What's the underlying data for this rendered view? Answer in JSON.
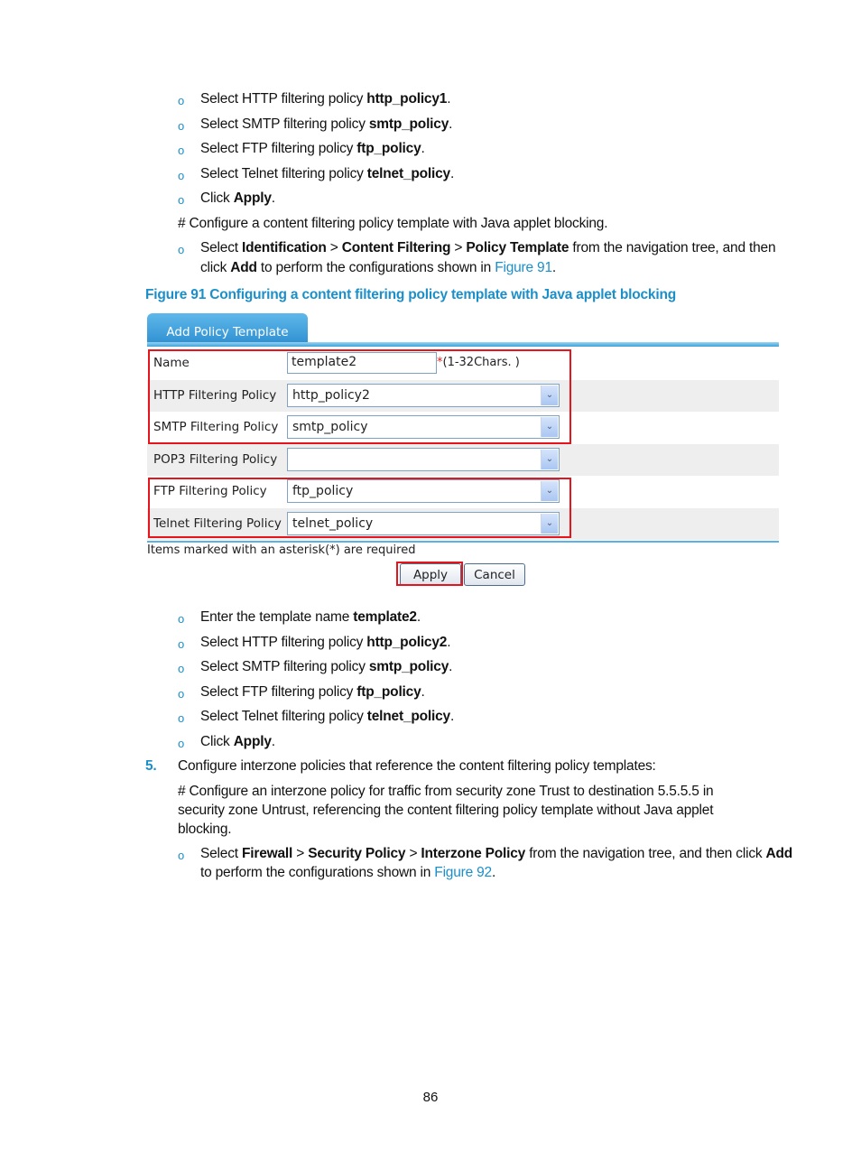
{
  "steps_before": [
    {
      "prefix": "Select HTTP filtering policy ",
      "bold": "http_policy1",
      "suffix": "."
    },
    {
      "prefix": "Select SMTP filtering policy ",
      "bold": "smtp_policy",
      "suffix": "."
    },
    {
      "prefix": "Select FTP filtering policy ",
      "bold": "ftp_policy",
      "suffix": "."
    },
    {
      "prefix": "Select Telnet filtering policy ",
      "bold": "telnet_policy",
      "suffix": "."
    },
    {
      "prefix": "Click ",
      "bold": "Apply",
      "suffix": "."
    }
  ],
  "comment_java": "# Configure a content filtering policy template with Java applet blocking.",
  "nav_step": {
    "select": "Select ",
    "path1": "Identification",
    "sep": " > ",
    "path2": "Content Filtering",
    "path3": "Policy Template",
    "rest1": " from the navigation tree, and then",
    "click": "click ",
    "add": "Add",
    "rest2": " to perform the configurations shown in ",
    "fig_link": "Figure 91",
    "end": "."
  },
  "figure_title": "Figure 91 Configuring a content filtering policy template with Java applet blocking",
  "form": {
    "tab_label": "Add Policy Template",
    "name_label": "Name",
    "name_value": "template2",
    "name_hint_star": "*",
    "name_hint": "(1-32Chars. )",
    "rows": [
      {
        "label": "HTTP Filtering Policy",
        "value": "http_policy2"
      },
      {
        "label": "SMTP Filtering Policy",
        "value": "smtp_policy"
      },
      {
        "label": "POP3 Filtering Policy",
        "value": ""
      },
      {
        "label": "FTP Filtering Policy",
        "value": "ftp_policy"
      },
      {
        "label": "Telnet Filtering Policy",
        "value": "telnet_policy"
      }
    ],
    "dropdown_icon": "chevron-down-icon",
    "required_note": "Items marked with an asterisk(*) are required",
    "apply_label": "Apply",
    "cancel_label": "Cancel",
    "highlight_color": "#e8141c",
    "accent_color": "#3da3db"
  },
  "steps_after": [
    {
      "prefix": "Enter the template name ",
      "bold": "template2",
      "suffix": "."
    },
    {
      "prefix": "Select HTTP filtering policy ",
      "bold": "http_policy2",
      "suffix": "."
    },
    {
      "prefix": "Select SMTP filtering policy ",
      "bold": "smtp_policy",
      "suffix": "."
    },
    {
      "prefix": "Select FTP filtering policy ",
      "bold": "ftp_policy",
      "suffix": "."
    },
    {
      "prefix": "Select Telnet filtering policy ",
      "bold": "telnet_policy",
      "suffix": "."
    },
    {
      "prefix": "Click ",
      "bold": "Apply",
      "suffix": "."
    }
  ],
  "step5": {
    "number": "5.",
    "text": "Configure interzone policies that reference the content filtering policy templates:",
    "comment_line1": "# Configure an interzone policy for traffic from security zone Trust to destination 5.5.5.5 in",
    "comment_line2": "security zone Untrust, referencing the content filtering policy template without Java applet",
    "comment_line3": "blocking.",
    "nav": {
      "select": "Select ",
      "path1": "Firewall",
      "sep": " > ",
      "path2": "Security Policy",
      "path3": "Interzone Policy",
      "rest1": " from the navigation tree, and then click ",
      "add": "Add",
      "rest2": "to perform the configurations shown in ",
      "fig_link": "Figure 92",
      "end": "."
    }
  },
  "bullet_glyph": "o",
  "page_number": "86"
}
